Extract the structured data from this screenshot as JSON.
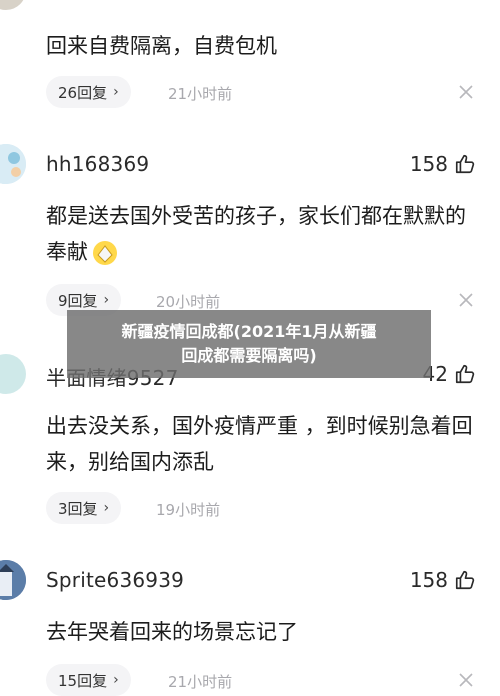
{
  "colors": {
    "muted": "#a8a8ad",
    "pill_bg": "#f4f4f6",
    "overlay_bg": "#6e6e6e"
  },
  "comments": [
    {
      "username": "",
      "likes": "",
      "text": "回来自费隔离，自费包机",
      "reply": "26回复",
      "time": "21小时前"
    },
    {
      "username": "hh168369",
      "likes": "158",
      "text": "都是送去国外受苦的孩子，家长们都在默默的奉献",
      "reply": "9回复",
      "time": "20小时前"
    },
    {
      "username": "半面情绪9527",
      "likes": "42",
      "text": "出去没关系，国外疫情严重 ，到时候别急着回来，别给国内添乱",
      "reply": "3回复",
      "time": "19小时前"
    },
    {
      "username": "Sprite636939",
      "likes": "158",
      "text": "去年哭着回来的场景忘记了",
      "reply": "15回复",
      "time": "21小时前"
    }
  ],
  "overlay": {
    "line1": "新疆疫情回成都(2021年1月从新疆",
    "line2": "回成都需要隔离吗)"
  }
}
